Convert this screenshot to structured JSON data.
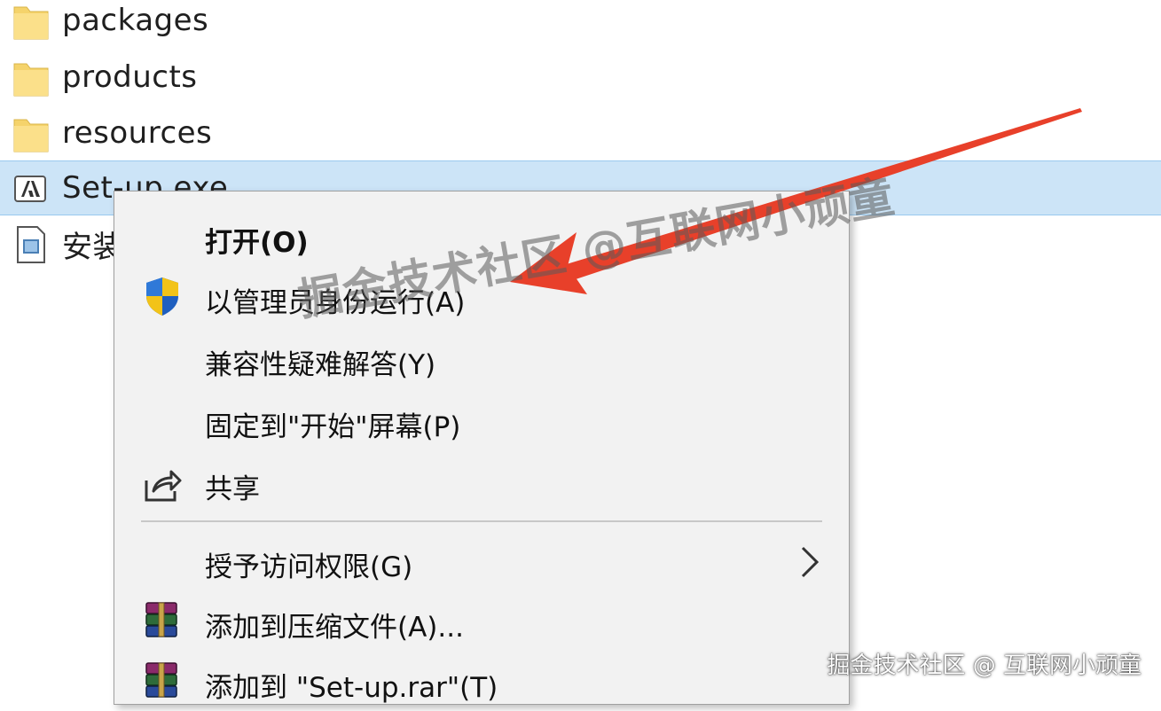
{
  "files": [
    {
      "name": "packages",
      "icon": "folder-icon"
    },
    {
      "name": "products",
      "icon": "folder-icon"
    },
    {
      "name": "resources",
      "icon": "folder-icon"
    },
    {
      "name": "Set-up.exe",
      "icon": "adobe-setup-icon",
      "selected": true
    },
    {
      "name": "安装",
      "icon": "text-document-icon"
    }
  ],
  "context_menu": {
    "open": "打开(O)",
    "run_as_admin": "以管理员身份运行(A)",
    "troubleshoot": "兼容性疑难解答(Y)",
    "pin_start": "固定到\"开始\"屏幕(P)",
    "share": "共享",
    "grant_access": "授予访问权限(G)",
    "add_archive": "添加到压缩文件(A)...",
    "add_rar": "添加到 \"Set-up.rar\"(T)"
  },
  "watermark": {
    "big": "掘金技术社区 @互联网小顽童",
    "corner": "掘金技术社区 @ 互联网小顽童"
  },
  "colors": {
    "selection": "#cce4f7",
    "menu_bg": "#f2f2f2",
    "arrow": "#e8402a",
    "folder": "#f7d774"
  }
}
